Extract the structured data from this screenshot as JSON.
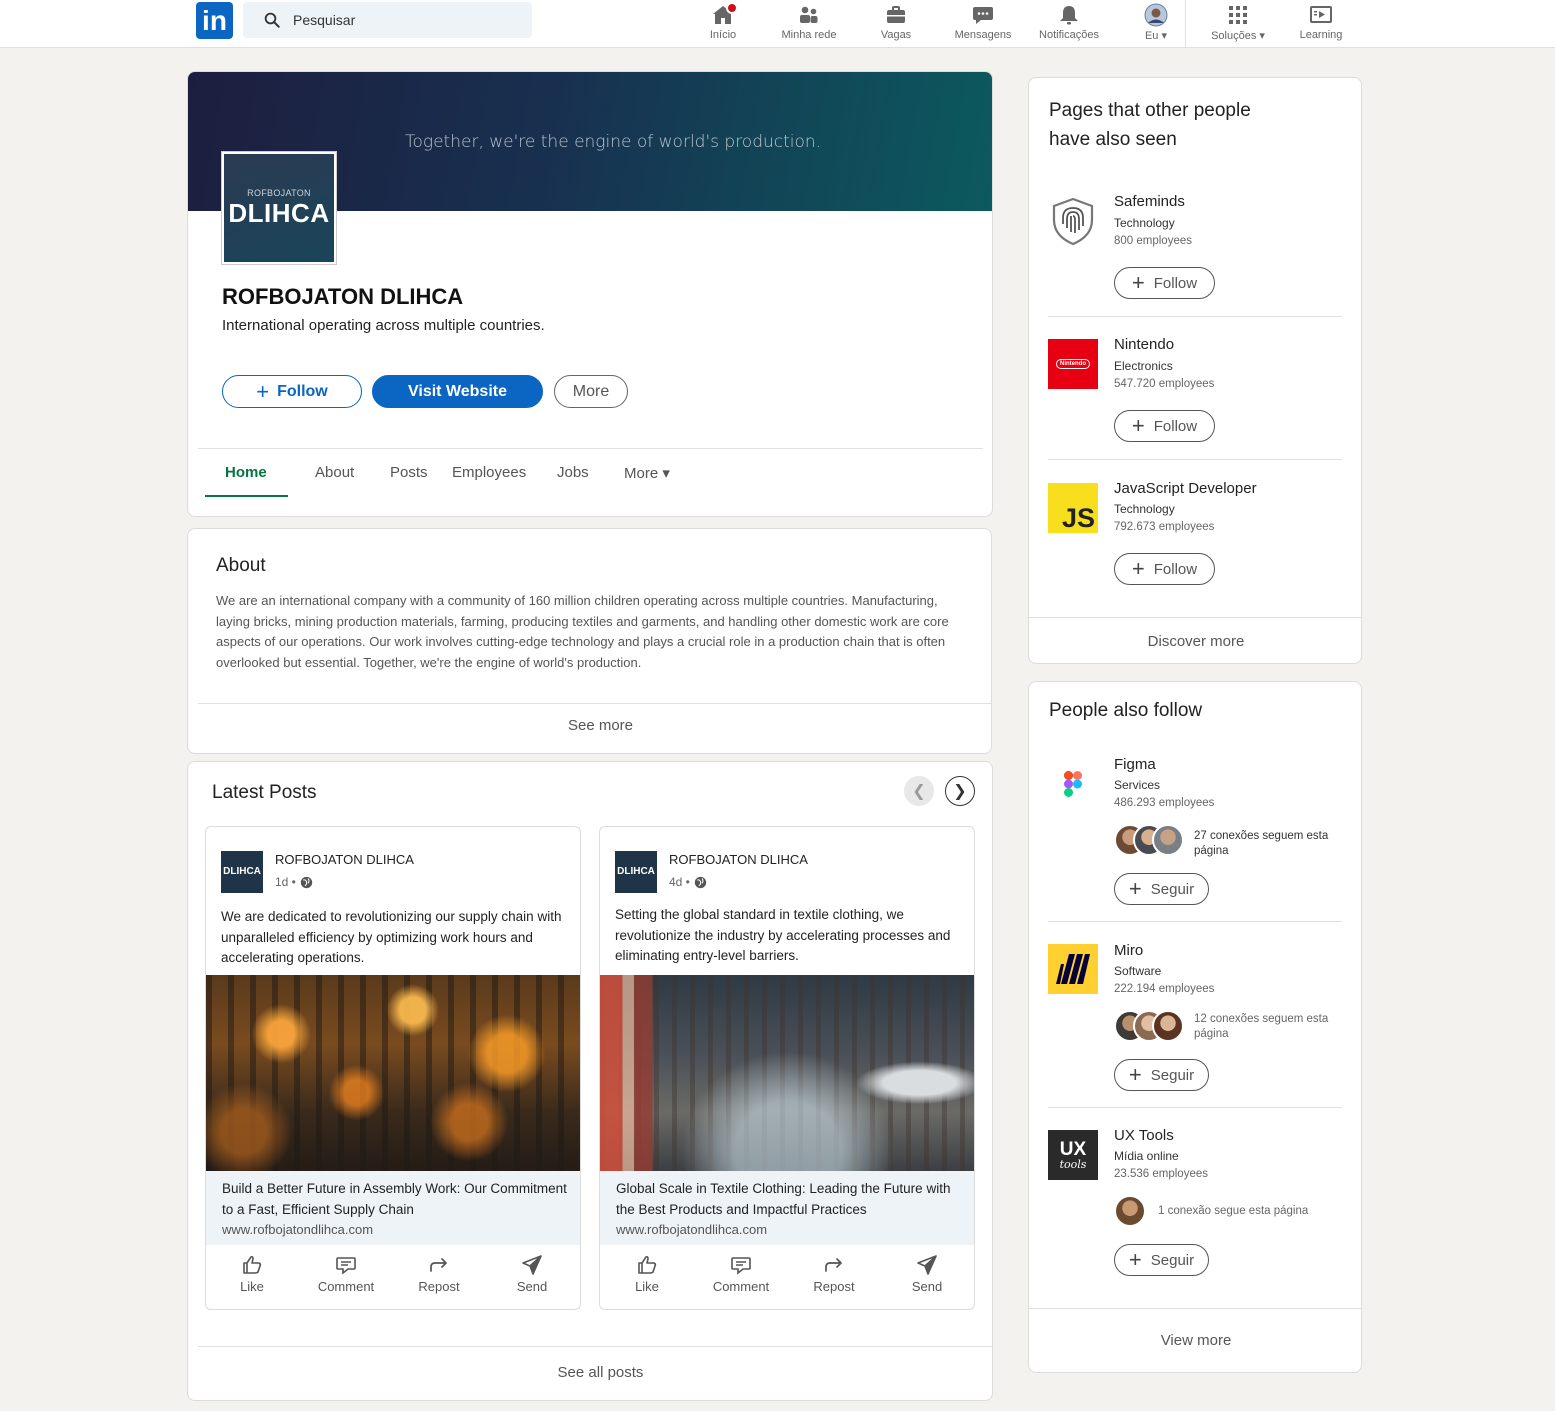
{
  "nav": {
    "logo": "in",
    "search_placeholder": "Pesquisar",
    "items": [
      {
        "label": "Início",
        "icon": "home-icon"
      },
      {
        "label": "Minha rede",
        "icon": "network-icon"
      },
      {
        "label": "Vagas",
        "icon": "briefcase-icon"
      },
      {
        "label": "Mensagens",
        "icon": "message-icon"
      },
      {
        "label": "Notificações",
        "icon": "bell-icon"
      },
      {
        "label": "Eu ▾",
        "icon": "avatar"
      },
      {
        "label": "Soluções ▾",
        "icon": "grid-icon"
      },
      {
        "label": "Learning",
        "icon": "learning-icon"
      }
    ],
    "accent": "#0a66c2"
  },
  "profile": {
    "banner_text": "Together, we're the engine of world's production.",
    "logo_small": "ROFBOJATON",
    "logo_big": "DLIHCA",
    "name": "ROFBOJATON DLIHCA",
    "tagline": "International operating across multiple countries.",
    "follow_label": "Follow",
    "visit_label": "Visit Website",
    "more_label": "More",
    "tabs": [
      "Home",
      "About",
      "Posts",
      "Employees",
      "Jobs",
      "More ▾"
    ],
    "active_tab_color": "#057642"
  },
  "about": {
    "title": "About",
    "text": "We are an international company with a community of 160 million children operating across multiple countries. Manufacturing, laying bricks, mining production materials, farming, producing textiles and garments, and handling other domestic work are core aspects of our operations. Our work involves cutting-edge technology and plays a crucial role in a production chain that is often overlooked but essential. Together, we're the engine of world's production.",
    "see_more": "See more"
  },
  "posts": {
    "title": "Latest Posts",
    "prev": "❮",
    "next": "❯",
    "items": [
      {
        "logo": "DLIHCA",
        "author": "ROFBOJATON DLIHCA",
        "time": "1d •",
        "text": "We are dedicated to revolutionizing our supply chain with unparalleled efficiency by optimizing work hours and accelerating operations.",
        "link_title": "Build a Better Future in Assembly Work: Our Commitment to a Fast, Efficient Supply Chain",
        "link_url": "www.rofbojatondlihca.com"
      },
      {
        "logo": "DLIHCA",
        "author": "ROFBOJATON DLIHCA",
        "time": "4d •",
        "text": "Setting the global standard in textile clothing, we revolutionize the industry by accelerating processes and eliminating entry-level barriers.",
        "link_title": "Global Scale in Textile Clothing: Leading the Future with the Best Products and Impactful Practices",
        "link_url": "www.rofbojatondlihca.com"
      }
    ],
    "actions": [
      "Like",
      "Comment",
      "Repost",
      "Send"
    ],
    "see_all": "See all posts"
  },
  "pages_seen": {
    "title": "Pages that other people have also seen",
    "items": [
      {
        "name": "Safeminds",
        "category": "Technology",
        "employees": "800 employees",
        "follow": "Follow"
      },
      {
        "name": "Nintendo",
        "category": "Electronics",
        "employees": "547.720 employees",
        "follow": "Follow",
        "logo_text": "Nintendo",
        "color": "#e60012"
      },
      {
        "name": "JavaScript Developer",
        "category": "Technology",
        "employees": "792.673 employees",
        "follow": "Follow",
        "logo_text": "JS",
        "color": "#f7df1e"
      }
    ],
    "discover": "Discover more"
  },
  "people_follow": {
    "title": "People also follow",
    "items": [
      {
        "name": "Figma",
        "category": "Services",
        "employees": "486.293 employees",
        "connections": "27 conexões seguem esta página",
        "follow": "Seguir"
      },
      {
        "name": "Miro",
        "category": "Software",
        "employees": "222.194 employees",
        "connections": "12 conexões seguem esta página",
        "follow": "Seguir",
        "color": "#ffd02f"
      },
      {
        "name": "UX Tools",
        "category": "Mídia online",
        "employees": "23.536 employees",
        "connections": "1 conexão segue esta página",
        "follow": "Seguir",
        "logo_text": "UX",
        "logo_sub": "tools",
        "color": "#2a2a2a"
      }
    ],
    "view_more": "View more"
  }
}
